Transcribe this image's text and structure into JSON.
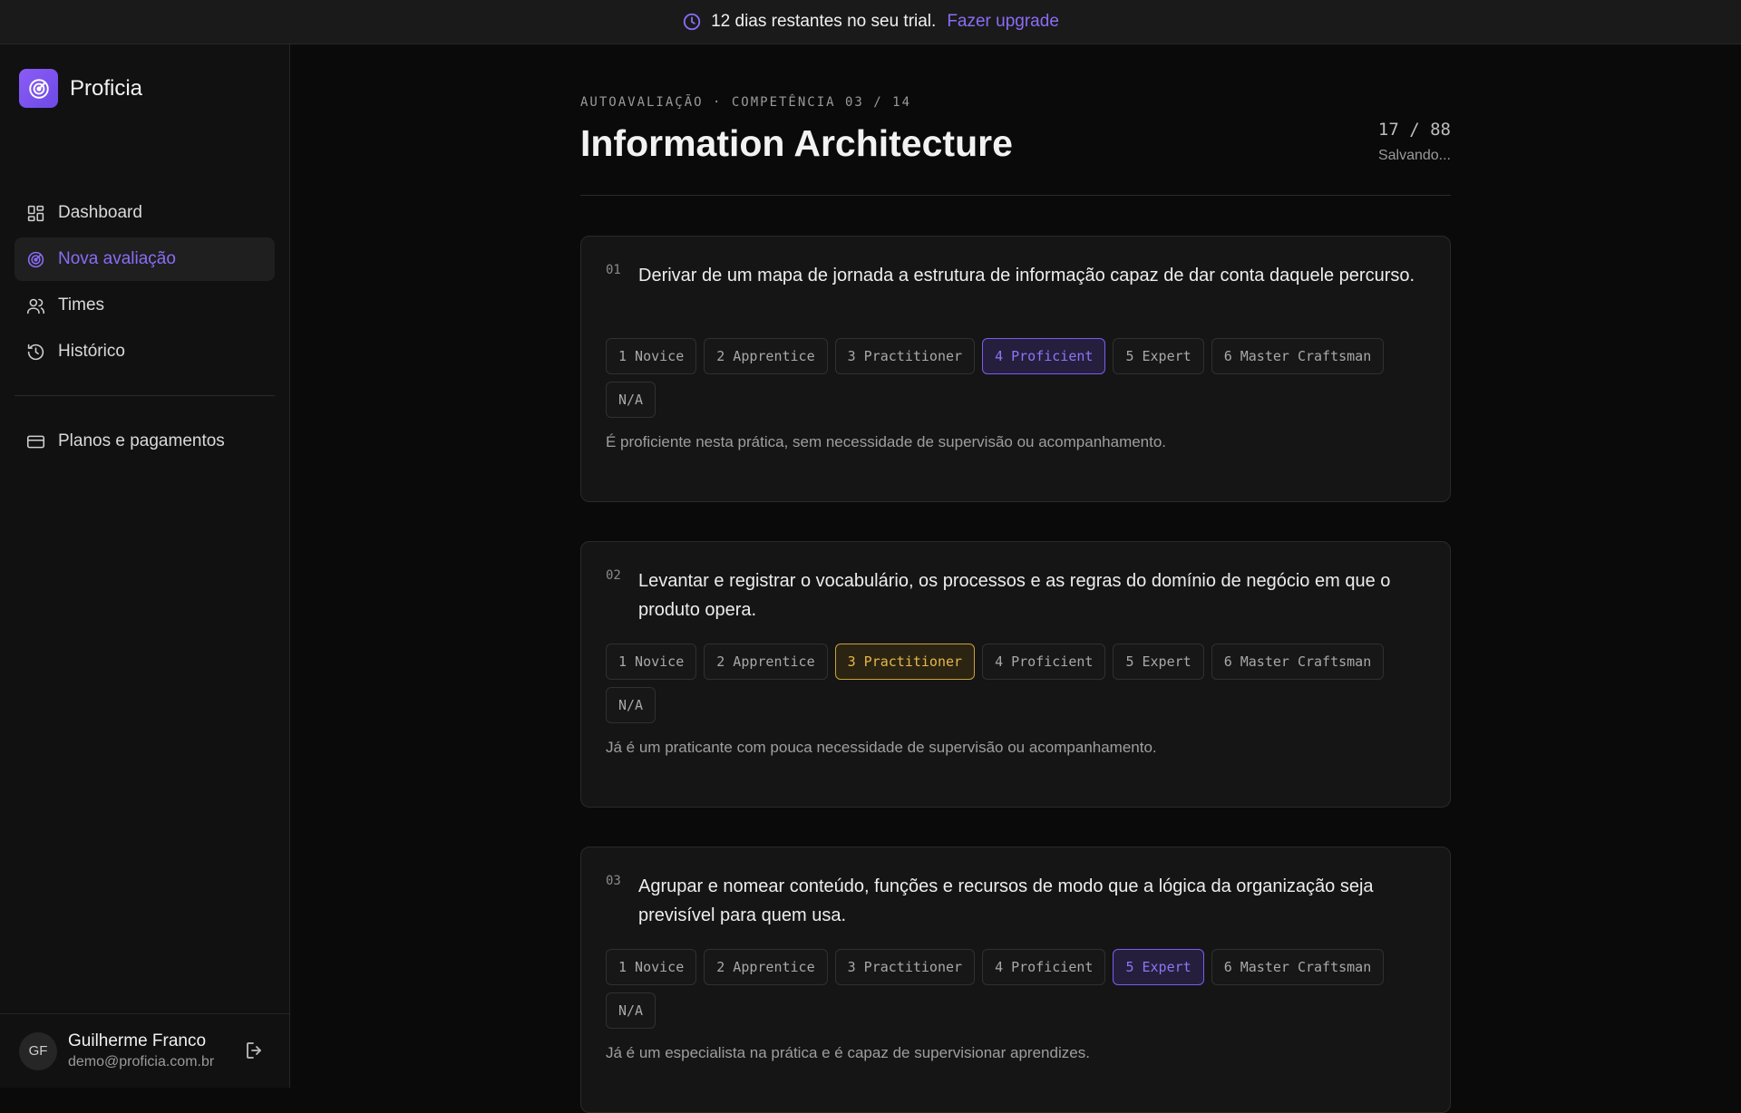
{
  "trial_banner": {
    "message": "12 dias restantes no seu trial.",
    "upgrade_label": "Fazer upgrade",
    "accent": "#8b6cf6"
  },
  "sidebar": {
    "brand": "Proficia",
    "nav": [
      {
        "label": "Dashboard",
        "icon": "grid-icon",
        "active": false
      },
      {
        "label": "Nova avaliação",
        "icon": "target-icon",
        "active": true
      },
      {
        "label": "Times",
        "icon": "users-icon",
        "active": false
      },
      {
        "label": "Histórico",
        "icon": "history-icon",
        "active": false
      }
    ],
    "secondary_nav": [
      {
        "label": "Planos e pagamentos",
        "icon": "credit-card-icon"
      }
    ],
    "user": {
      "initials": "GF",
      "name": "Guilherme Franco",
      "email": "demo@proficia.com.br"
    }
  },
  "assessment": {
    "eyebrow": "AUTOAVALIAÇÃO · COMPETÊNCIA 03 / 14",
    "title": "Information Architecture",
    "progress": "17 / 88",
    "save_status": "Salvando...",
    "levels": [
      "1 Novice",
      "2 Apprentice",
      "3 Practitioner",
      "4 Proficient",
      "5 Expert",
      "6 Master Craftsman",
      "N/A"
    ],
    "questions": [
      {
        "number": "01",
        "text": "Derivar de um mapa de jornada a estrutura de informação capaz de dar conta daquele percurso.",
        "selected_index": 3,
        "selected_color": "purple",
        "description": "É proficiente nesta prática, sem necessidade de supervisão ou acompanhamento."
      },
      {
        "number": "02",
        "text": "Levantar e registrar o vocabulário, os processos e as regras do domínio de negócio em que o produto opera.",
        "selected_index": 2,
        "selected_color": "amber",
        "description": "Já é um praticante com pouca necessidade de supervisão ou acompanhamento."
      },
      {
        "number": "03",
        "text": "Agrupar e nomear conteúdo, funções e recursos de modo que a lógica da organização seja previsível para quem usa.",
        "selected_index": 4,
        "selected_color": "purple",
        "description": "Já é um especialista na prática e é capaz de supervisionar aprendizes."
      }
    ]
  }
}
